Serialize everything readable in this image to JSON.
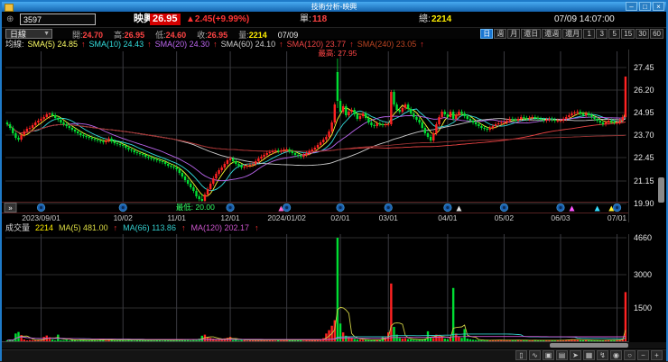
{
  "window": {
    "title": "技術分析-映興",
    "controls": [
      {
        "name": "minimize",
        "glyph": "–"
      },
      {
        "name": "maximize",
        "glyph": "□"
      },
      {
        "name": "close",
        "glyph": "×"
      }
    ]
  },
  "quote_bar": {
    "target_icon": "⊕",
    "symbol": "3597",
    "name": "映興",
    "price": "26.95",
    "change": "▲2.45(+9.99%)",
    "single_label": "單:",
    "single_value": "118",
    "total_label": "總:",
    "total_value": "2214",
    "datetime": "07/09 14:07:00",
    "accent_up": "#ff3333",
    "accent_total": "#ffee00"
  },
  "toolbar": {
    "period_dropdown": "日線",
    "ohlc": [
      {
        "label": "開:",
        "value": "24.70",
        "color": "#ff4444"
      },
      {
        "label": "高:",
        "value": "26.95",
        "color": "#ff4444"
      },
      {
        "label": "低:",
        "value": "24.60",
        "color": "#ff4444"
      },
      {
        "label": "收:",
        "value": "26.95",
        "color": "#ff4444"
      },
      {
        "label": "量:",
        "value": "2214",
        "color": "#ffee00"
      }
    ],
    "date": "07/09",
    "period_buttons": [
      {
        "label": "日",
        "active": true
      },
      {
        "label": "週",
        "active": false
      },
      {
        "label": "月",
        "active": false
      },
      {
        "label": "還日",
        "active": false
      },
      {
        "label": "還週",
        "active": false
      },
      {
        "label": "還月",
        "active": false
      },
      {
        "label": "1",
        "active": false
      },
      {
        "label": "3",
        "active": false
      },
      {
        "label": "5",
        "active": false
      },
      {
        "label": "15",
        "active": false
      },
      {
        "label": "30",
        "active": false
      },
      {
        "label": "60",
        "active": false
      }
    ]
  },
  "ma_legend": {
    "prefix": "均線:",
    "arrow": "↑",
    "arrow_color": "#ff3333",
    "items": [
      {
        "label": "SMA(5)",
        "value": "24.85",
        "color": "#ffff66"
      },
      {
        "label": "SMA(10)",
        "value": "24.43",
        "color": "#33dddd"
      },
      {
        "label": "SMA(20)",
        "value": "24.30",
        "color": "#bb66ee"
      },
      {
        "label": "SMA(60)",
        "value": "24.10",
        "color": "#cccccc"
      },
      {
        "label": "SMA(120)",
        "value": "23.77",
        "color": "#ee4444"
      },
      {
        "label": "SMA(240)",
        "value": "23.05",
        "color": "#bb4422"
      }
    ]
  },
  "volume_legend": {
    "title": "成交量",
    "volume": "2214",
    "volume_color": "#ffee00",
    "arrow": "↑",
    "arrow_color": "#ff3333",
    "items": [
      {
        "label": "MA(5)",
        "value": "481.00",
        "color": "#dddd44"
      },
      {
        "label": "MA(66)",
        "value": "113.86",
        "color": "#33cccc"
      },
      {
        "label": "MA(120)",
        "value": "202.17",
        "color": "#cc55cc"
      }
    ]
  },
  "bottom_toolbar": {
    "icons": [
      {
        "name": "document",
        "glyph": "▯"
      },
      {
        "name": "chart-line",
        "glyph": "∿"
      },
      {
        "name": "save",
        "glyph": "▣"
      },
      {
        "name": "print",
        "glyph": "▤"
      },
      {
        "name": "pointer",
        "glyph": "➤"
      },
      {
        "name": "grid",
        "glyph": "▦"
      },
      {
        "name": "indicator",
        "glyph": "↯"
      },
      {
        "name": "eye",
        "glyph": "◉"
      },
      {
        "name": "circle",
        "glyph": "○"
      },
      {
        "name": "zoom-out",
        "glyph": "−"
      },
      {
        "name": "zoom-in",
        "glyph": "+"
      }
    ]
  },
  "chart_data": {
    "type": "candlestick+volume",
    "up_color": "#ff2222",
    "down_color": "#00dd33",
    "grid_h_color": "#2e2e2e",
    "grid_v_color": "#3a3a40",
    "price_ticks": [
      27.45,
      26.2,
      24.95,
      23.7,
      22.45,
      21.15,
      19.9
    ],
    "price_range": [
      20.0,
      28.45
    ],
    "volume_ticks": [
      4660,
      3000,
      1500
    ],
    "volume_max": 4660,
    "x_labels": [
      {
        "label": "2023/09/01",
        "idx": 12
      },
      {
        "label": "10/02",
        "idx": 41
      },
      {
        "label": "11/01",
        "idx": 60
      },
      {
        "label": "12/01",
        "idx": 79
      },
      {
        "label": "2024/01/02",
        "idx": 99
      },
      {
        "label": "02/01",
        "idx": 118
      },
      {
        "label": "03/01",
        "idx": 135
      },
      {
        "label": "04/01",
        "idx": 156
      },
      {
        "label": "05/02",
        "idx": 176
      },
      {
        "label": "06/03",
        "idx": 196
      },
      {
        "label": "07/01",
        "idx": 216
      }
    ],
    "annotations": {
      "high": {
        "text": "最高: 27.95",
        "idx": 117,
        "color": "#ff4444"
      },
      "low": {
        "text": "最低: 20.00",
        "idx": 69,
        "color": "#33ff66"
      }
    },
    "price_mas": [
      {
        "n": 5,
        "color": "#ffff33"
      },
      {
        "n": 10,
        "color": "#33dddd"
      },
      {
        "n": 20,
        "color": "#bb66ee"
      },
      {
        "n": 60,
        "color": "#cccccc"
      },
      {
        "n": 120,
        "color": "#ee4444"
      },
      {
        "n": 240,
        "color": "#993333"
      }
    ],
    "volume_mas": [
      {
        "n": 5,
        "color": "#cccc44"
      },
      {
        "n": 66,
        "color": "#33cccc"
      },
      {
        "n": 120,
        "color": "#cc55cc"
      }
    ],
    "event_markers": {
      "circles": [
        12,
        41,
        79,
        99,
        118,
        135,
        156,
        176,
        196,
        216
      ],
      "circle_color": "#1a5fae",
      "triangles": [
        {
          "idx": 97,
          "color": "#ff66cc"
        },
        {
          "idx": 160,
          "color": "#dddddd"
        },
        {
          "idx": 200,
          "color": "#ff55ff"
        },
        {
          "idx": 209,
          "color": "#33ddff"
        },
        {
          "idx": 214,
          "color": "#ffee33"
        }
      ]
    },
    "expand_button": "»",
    "opens_override": {
      "0": 24.4,
      "117": 27.2
    },
    "hl_override": {
      "15": [
        24.95,
        24.6
      ],
      "69": [
        20.45,
        20.0
      ],
      "117": [
        27.95,
        25.2
      ],
      "136": [
        26.2,
        24.2
      ],
      "219": [
        26.95,
        24.6
      ]
    },
    "closes": [
      24.3,
      24.1,
      23.8,
      23.55,
      23.45,
      23.7,
      23.9,
      24.05,
      24.1,
      24.25,
      24.4,
      24.5,
      24.6,
      24.7,
      24.85,
      24.9,
      24.8,
      24.65,
      24.55,
      24.4,
      24.3,
      24.2,
      24.1,
      24.0,
      23.9,
      23.8,
      23.7,
      23.65,
      23.6,
      23.55,
      23.5,
      23.45,
      23.4,
      23.35,
      23.3,
      23.4,
      23.5,
      23.35,
      23.25,
      23.2,
      23.15,
      23.1,
      23.0,
      22.9,
      22.85,
      22.75,
      22.7,
      22.65,
      22.6,
      22.5,
      22.45,
      22.4,
      22.35,
      22.3,
      22.25,
      22.2,
      22.1,
      22.0,
      21.95,
      21.9,
      21.8,
      21.6,
      21.4,
      21.2,
      21.0,
      20.8,
      20.6,
      20.3,
      20.15,
      20.05,
      20.4,
      20.7,
      21.0,
      21.3,
      21.55,
      21.75,
      21.9,
      22.1,
      22.3,
      22.4,
      22.25,
      22.1,
      22.0,
      21.9,
      21.95,
      22.0,
      22.05,
      22.1,
      22.25,
      22.4,
      22.5,
      22.6,
      22.7,
      22.75,
      22.8,
      22.85,
      22.8,
      22.85,
      22.9,
      22.9,
      22.8,
      22.7,
      22.6,
      22.55,
      22.5,
      22.6,
      22.7,
      22.8,
      22.9,
      23.0,
      23.15,
      23.3,
      23.45,
      23.6,
      23.9,
      24.4,
      25.4,
      25.6,
      25.0,
      25.3,
      24.8,
      25.0,
      25.1,
      24.85,
      24.6,
      24.75,
      24.9,
      24.65,
      24.4,
      24.25,
      24.2,
      24.35,
      24.3,
      24.25,
      24.3,
      24.3,
      26.1,
      25.4,
      25.1,
      25.0,
      25.2,
      25.4,
      25.15,
      24.9,
      24.7,
      24.55,
      24.4,
      24.1,
      23.8,
      23.6,
      23.4,
      23.8,
      24.3,
      24.7,
      25.0,
      24.85,
      24.7,
      25.0,
      24.6,
      24.8,
      25.0,
      24.9,
      24.75,
      24.6,
      24.5,
      24.4,
      24.3,
      24.2,
      24.1,
      24.05,
      24.0,
      24.1,
      24.2,
      24.3,
      24.35,
      24.4,
      24.4,
      24.5,
      24.6,
      24.55,
      24.5,
      24.6,
      24.7,
      24.65,
      24.6,
      24.65,
      24.7,
      24.65,
      24.6,
      24.55,
      24.5,
      24.55,
      24.6,
      24.55,
      24.5,
      24.5,
      24.5,
      24.6,
      24.7,
      24.8,
      24.9,
      24.95,
      25.0,
      24.9,
      24.8,
      24.9,
      24.8,
      24.7,
      24.6,
      24.5,
      24.4,
      24.3,
      24.4,
      24.5,
      24.45,
      24.4,
      24.4,
      24.5,
      24.7,
      26.95
    ],
    "volumes": [
      45,
      70,
      35,
      350,
      420,
      280,
      80,
      40,
      60,
      50,
      45,
      70,
      35,
      200,
      260,
      180,
      80,
      40,
      300,
      50,
      45,
      70,
      35,
      90,
      55,
      30,
      80,
      40,
      60,
      50,
      45,
      70,
      35,
      90,
      55,
      30,
      80,
      40,
      60,
      50,
      45,
      70,
      35,
      90,
      55,
      30,
      80,
      40,
      60,
      50,
      45,
      70,
      35,
      90,
      55,
      30,
      80,
      40,
      60,
      50,
      60,
      80,
      45,
      100,
      70,
      40,
      90,
      60,
      120,
      250,
      300,
      180,
      150,
      120,
      90,
      110,
      80,
      130,
      160,
      200,
      45,
      70,
      35,
      90,
      55,
      30,
      80,
      40,
      60,
      50,
      45,
      70,
      35,
      90,
      55,
      30,
      80,
      40,
      60,
      50,
      45,
      70,
      35,
      90,
      55,
      30,
      80,
      40,
      60,
      50,
      80,
      100,
      140,
      350,
      500,
      700,
      950,
      4660,
      800,
      400,
      250,
      180,
      140,
      110,
      90,
      80,
      70,
      60,
      55,
      50,
      60,
      80,
      50,
      200,
      180,
      400,
      2600,
      650,
      300,
      150,
      120,
      140,
      100,
      90,
      70,
      60,
      80,
      100,
      120,
      450,
      200,
      150,
      300,
      250,
      180,
      120,
      90,
      140,
      2400,
      350,
      200,
      150,
      550,
      120,
      90,
      70,
      60,
      50,
      45,
      40,
      45,
      50,
      55,
      60,
      50,
      45,
      40,
      55,
      60,
      50,
      45,
      50,
      40,
      55,
      45,
      40,
      50,
      45,
      40,
      45,
      40,
      45,
      50,
      45,
      40,
      45,
      50,
      60,
      70,
      80,
      90,
      70,
      60,
      55,
      50,
      60,
      50,
      45,
      40,
      45,
      50,
      45,
      55,
      60,
      50,
      45,
      60,
      80,
      120,
      2214
    ]
  }
}
